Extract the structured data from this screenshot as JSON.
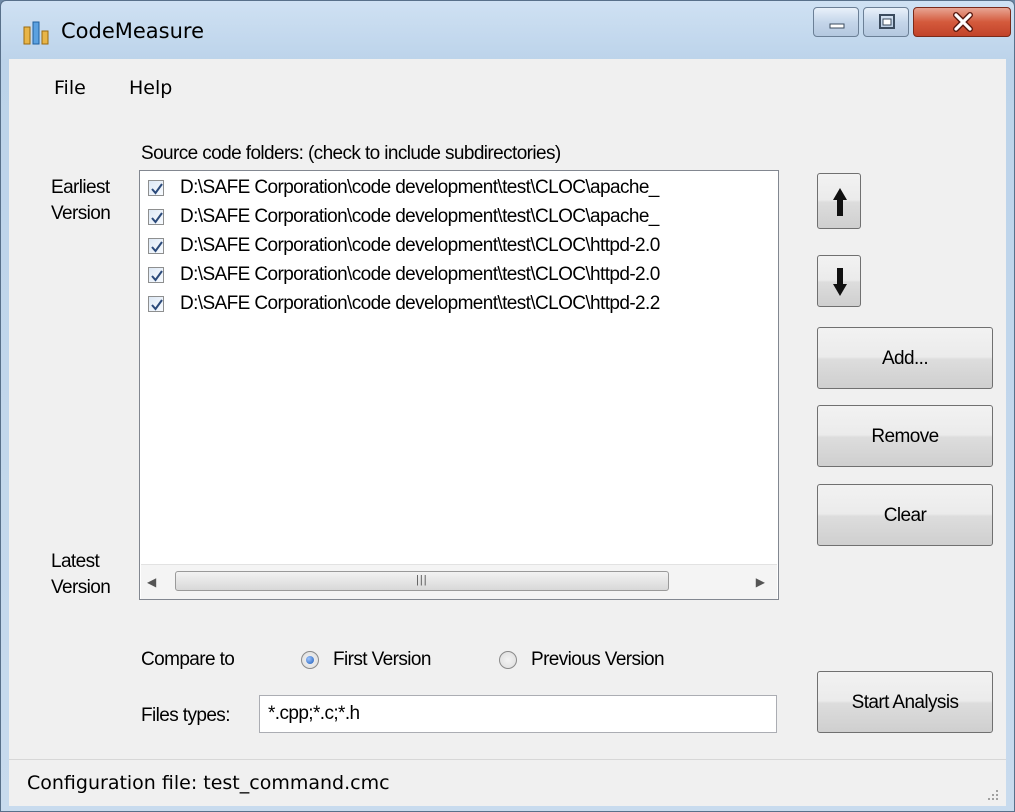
{
  "window": {
    "title": "CodeMeasure",
    "icon": "bar-chart-icon",
    "controls": [
      "minimize-icon",
      "maximize-icon",
      "close-icon"
    ]
  },
  "menu": {
    "file": "File",
    "help": "Help"
  },
  "folders": {
    "label": "Source code folders: (check to include subdirectories)",
    "earliest_label": "Earliest Version",
    "latest_label": "Latest Version",
    "items": [
      {
        "path": "D:\\SAFE Corporation\\code development\\test\\CLOC\\apache_",
        "checked": true
      },
      {
        "path": "D:\\SAFE Corporation\\code development\\test\\CLOC\\apache_",
        "checked": true
      },
      {
        "path": "D:\\SAFE Corporation\\code development\\test\\CLOC\\httpd-2.0",
        "checked": true
      },
      {
        "path": "D:\\SAFE Corporation\\code development\\test\\CLOC\\httpd-2.0",
        "checked": true
      },
      {
        "path": "D:\\SAFE Corporation\\code development\\test\\CLOC\\httpd-2.2",
        "checked": true
      }
    ]
  },
  "buttons": {
    "move_up": "arrow-up-icon",
    "move_down": "arrow-down-icon",
    "add": "Add...",
    "remove": "Remove",
    "clear": "Clear",
    "start": "Start Analysis"
  },
  "compare": {
    "label": "Compare to",
    "options": [
      {
        "label": "First Version",
        "selected": true
      },
      {
        "label": "Previous Version",
        "selected": false
      }
    ]
  },
  "filetypes": {
    "label": "Files types:",
    "value": "*.cpp;*.c;*.h"
  },
  "status": {
    "text": "Configuration file: test_command.cmc"
  },
  "colors": {
    "title_bar": "#bcd3ea",
    "close_button": "#c2432a",
    "window_bg": "#f0f0f0",
    "radio_selected": "#1c5bb8"
  }
}
